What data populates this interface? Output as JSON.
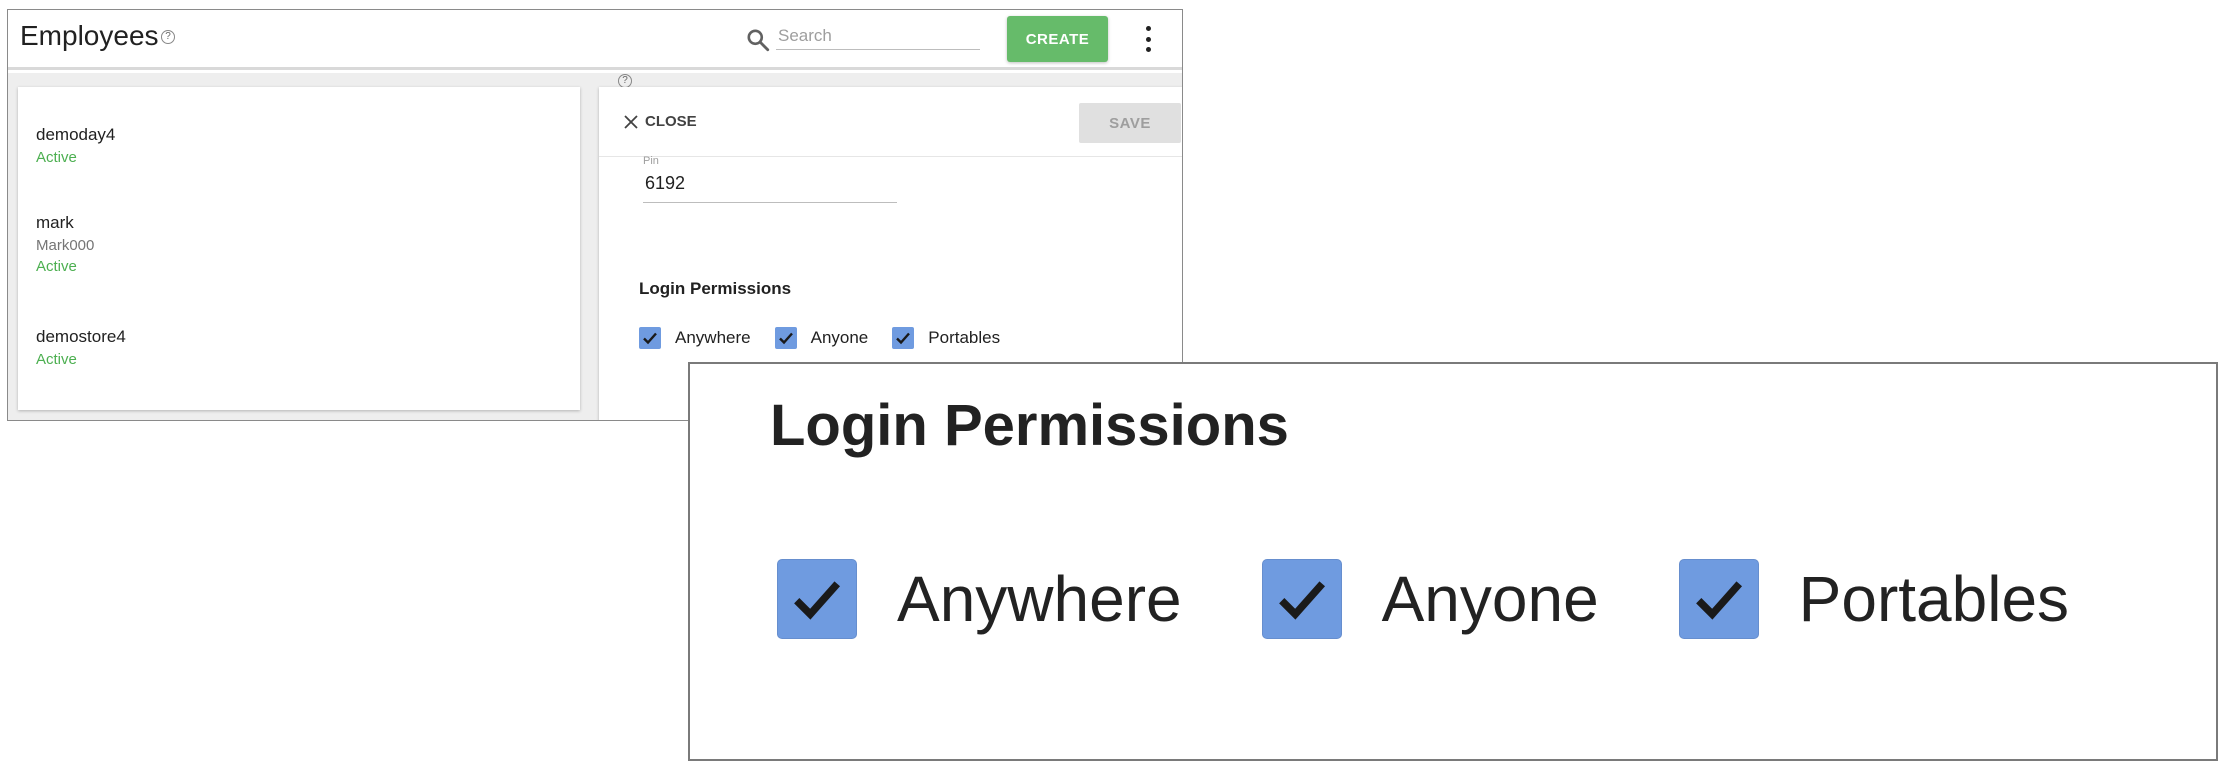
{
  "header": {
    "title": "Employees",
    "help_glyph": "?",
    "search_placeholder": "Search",
    "create_label": "CREATE"
  },
  "employees": [
    {
      "name": "demoday4",
      "sub": "",
      "status": "Active"
    },
    {
      "name": "mark",
      "sub": "Mark000",
      "status": "Active"
    },
    {
      "name": "demostore4",
      "sub": "",
      "status": "Active"
    }
  ],
  "detail": {
    "close_label": "CLOSE",
    "save_label": "SAVE",
    "pin_label": "Pin",
    "pin_value": "6192",
    "permissions_title": "Login Permissions",
    "permissions": [
      {
        "label": "Anywhere",
        "checked": true
      },
      {
        "label": "Anyone",
        "checked": true
      },
      {
        "label": "Portables",
        "checked": true
      }
    ]
  },
  "zoom": {
    "title": "Login Permissions",
    "permissions": [
      {
        "label": "Anywhere",
        "checked": true
      },
      {
        "label": "Anyone",
        "checked": true
      },
      {
        "label": "Portables",
        "checked": true
      }
    ]
  },
  "colors": {
    "accent_green": "#66bb6a",
    "status_green": "#4caf50",
    "checkbox_blue": "#6f9be0"
  },
  "icons": [
    "help-icon",
    "search-icon",
    "more-vert-icon",
    "close-icon",
    "checkmark-icon"
  ]
}
